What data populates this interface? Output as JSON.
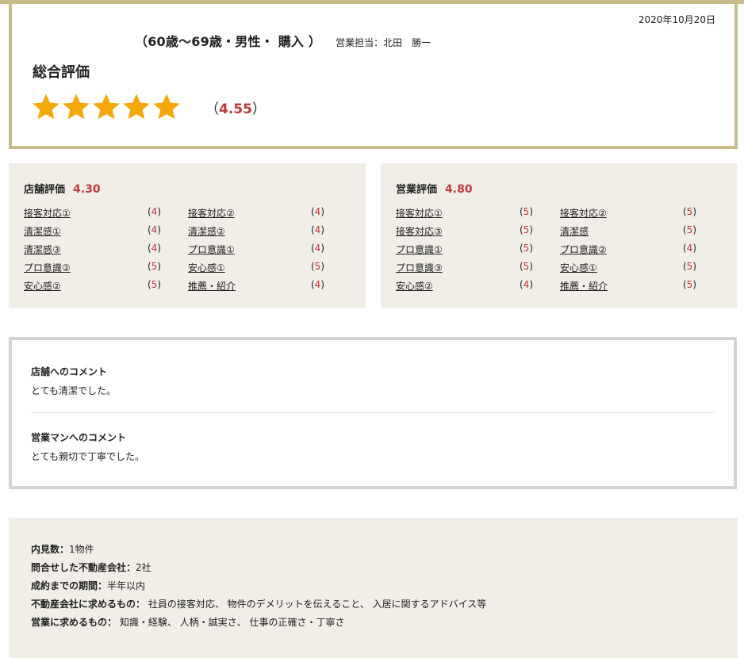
{
  "summary": {
    "date": "2020年10月20日",
    "profile": "（60歳〜69歳・男性・ 購入 ）",
    "sales_staff": "営業担当：北田　勝一",
    "overall_title": "総合評価",
    "overall_rating": 5,
    "overall_score_open": "（",
    "overall_score": "4.55",
    "overall_score_close": "）",
    "star_color": "#f5a80a"
  },
  "store_eval": {
    "title": "店舗評価",
    "score": "4.30",
    "items": [
      {
        "label": "接客対応①",
        "score": "4"
      },
      {
        "label": "接客対応②",
        "score": "4"
      },
      {
        "label": "清潔感①",
        "score": "4"
      },
      {
        "label": "清潔感②",
        "score": "4"
      },
      {
        "label": "清潔感③",
        "score": "4"
      },
      {
        "label": "プロ意識①",
        "score": "4"
      },
      {
        "label": "プロ意識②",
        "score": "5"
      },
      {
        "label": "安心感①",
        "score": "5"
      },
      {
        "label": "安心感②",
        "score": "5"
      },
      {
        "label": "推薦・紹介",
        "score": "4"
      }
    ]
  },
  "sales_eval": {
    "title": "営業評価",
    "score": "4.80",
    "items": [
      {
        "label": "接客対応①",
        "score": "5"
      },
      {
        "label": "接客対応②",
        "score": "5"
      },
      {
        "label": "接客対応③",
        "score": "5"
      },
      {
        "label": "清潔感",
        "score": "5"
      },
      {
        "label": "プロ意識①",
        "score": "5"
      },
      {
        "label": "プロ意識②",
        "score": "4"
      },
      {
        "label": "プロ意識③",
        "score": "5"
      },
      {
        "label": "安心感①",
        "score": "5"
      },
      {
        "label": "安心感②",
        "score": "4"
      },
      {
        "label": "推薦・紹介",
        "score": "5"
      }
    ]
  },
  "comments": {
    "store_title": "店舗へのコメント",
    "store_text": "とても清潔でした。",
    "sales_title": "営業マンへのコメント",
    "sales_text": "とても親切で丁寧でした。"
  },
  "info": [
    {
      "key": "内見数：",
      "value": "1物件"
    },
    {
      "key": "問合せした不動産会社：",
      "value": "2社"
    },
    {
      "key": "成約までの期間：",
      "value": "半年以内"
    },
    {
      "key": "不動産会社に求めるもの：",
      "value": " 社員の接客対応、 物件のデメリットを伝えること、 入居に関するアドバイス等"
    },
    {
      "key": "営業に求めるもの：",
      "value": " 知識・経験、 人柄・誠実さ、 仕事の正確さ・丁寧さ"
    }
  ],
  "colors": {
    "accent_gold": "#c8bb8a",
    "score_red": "#c0393b",
    "panel_bg": "#f1eee8"
  }
}
